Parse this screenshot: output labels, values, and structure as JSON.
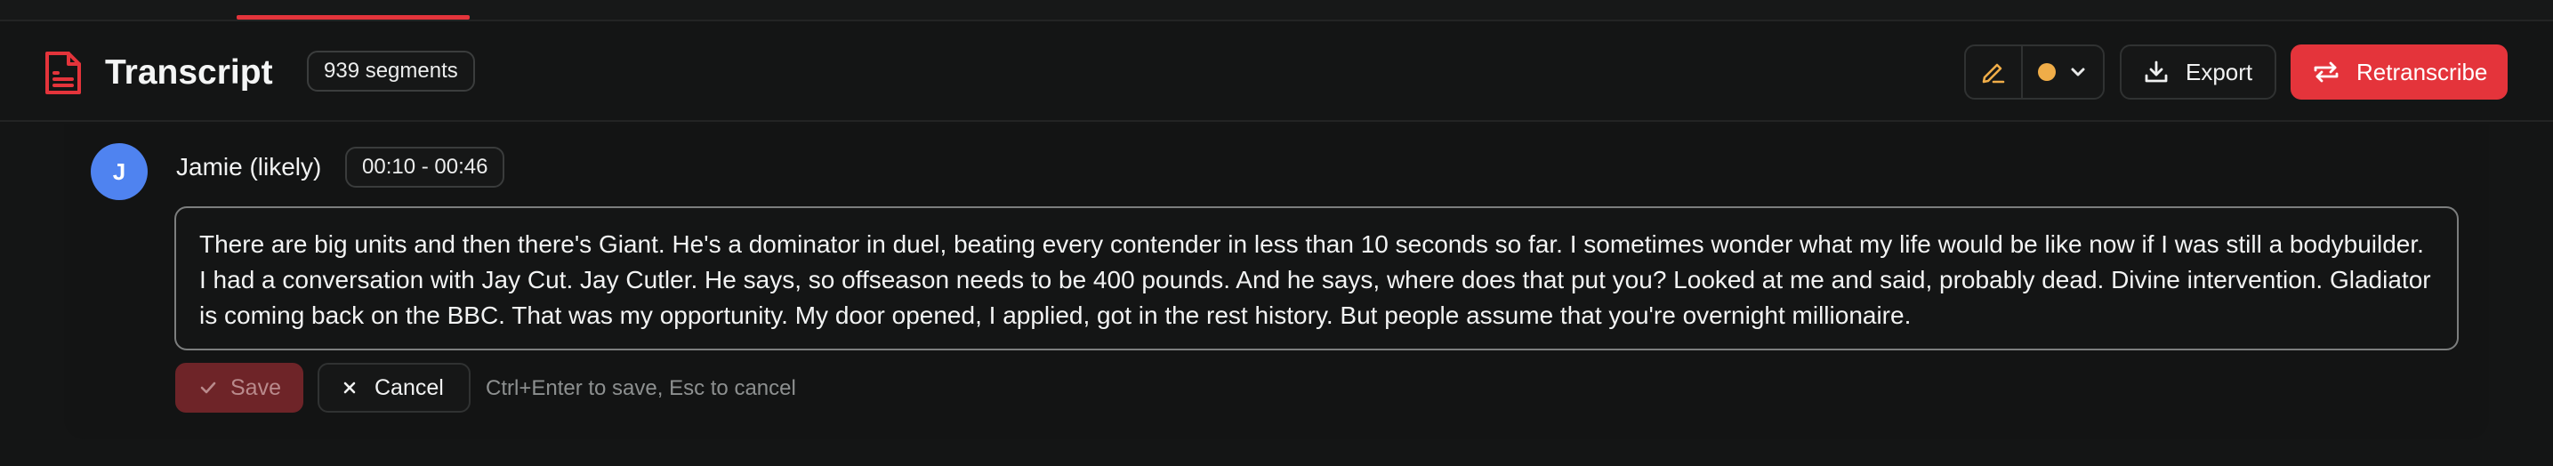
{
  "header": {
    "title": "Transcript",
    "segments_badge": "939 segments",
    "status_color": "#f0ad48",
    "export_label": "Export",
    "retranscribe_label": "Retranscribe"
  },
  "segment": {
    "avatar_initial": "J",
    "speaker": "Jamie (likely)",
    "time_range": "00:10 - 00:46",
    "text": "There are big units and then there's Giant. He's a dominator in duel, beating every contender in less than 10 seconds so far. I sometimes wonder what my life would be like now if I was still a bodybuilder. I had a conversation with Jay Cut. Jay Cutler. He says, so offseason needs to be 400 pounds. And he says, where does that put you? Looked at me and said, probably dead. Divine intervention. Gladiator is coming back on the BBC. That was my opportunity. My door opened, I applied, got in the rest history. But people assume that you're overnight millionaire."
  },
  "editor": {
    "save_label": "Save",
    "cancel_label": "Cancel",
    "hint": "Ctrl+Enter to save, Esc to cancel"
  },
  "colors": {
    "accent": "#e4343b",
    "avatar": "#4f83f0"
  },
  "icons": [
    "document-icon",
    "pencil-icon",
    "chevron-down-icon",
    "download-icon",
    "retranscribe-icon",
    "check-icon",
    "close-icon"
  ]
}
